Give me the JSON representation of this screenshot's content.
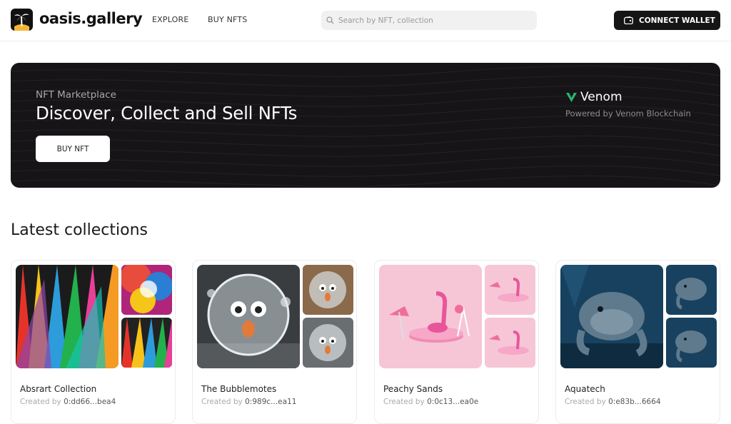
{
  "header": {
    "brand": "oasis.gallery",
    "nav": [
      "EXPLORE",
      "BUY NFTS"
    ],
    "search_placeholder": "Search by NFT, collection",
    "wallet_label": "CONNECT WALLET"
  },
  "hero": {
    "kicker": "NFT Marketplace",
    "title": "Discover, Collect and Sell NFTs",
    "button": "BUY NFT",
    "chain_name": "Venom",
    "powered": "Powered by Venom Blockchain"
  },
  "section_title": "Latest collections",
  "created_by_label": "Created by",
  "collections": [
    {
      "name": "Absrart Collection",
      "creator": "0:dd66...bea4"
    },
    {
      "name": "The Bubblemotes",
      "creator": "0:989c...ea11"
    },
    {
      "name": "Peachy Sands",
      "creator": "0:0c13...ea0e"
    },
    {
      "name": "Aquatech",
      "creator": "0:e83b...6664"
    }
  ],
  "colors": {
    "dark": "#151515",
    "accent": "#2bb673",
    "muted": "#aaaaaa"
  },
  "icons": [
    "palm-tree-logo",
    "search-icon",
    "wallet-icon",
    "venom-logo-icon"
  ]
}
